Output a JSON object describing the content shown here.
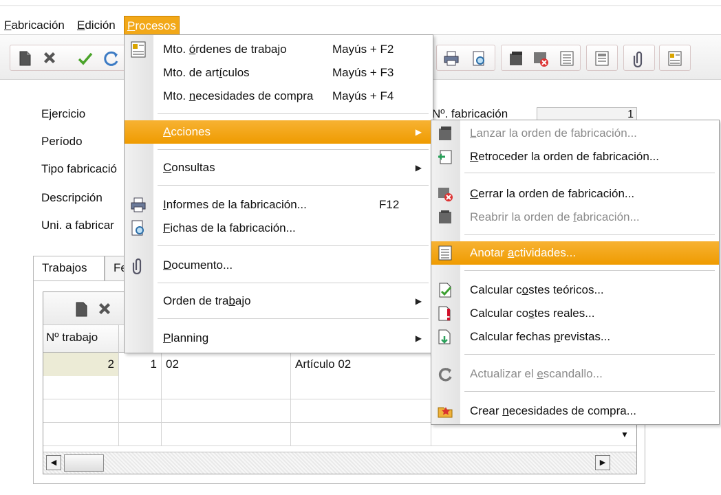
{
  "menubar": {
    "items": [
      {
        "pre": "",
        "key": "F",
        "post": "abricación"
      },
      {
        "pre": "",
        "key": "E",
        "post": "dición"
      },
      {
        "pre": "",
        "key": "P",
        "post": "rocesos"
      }
    ]
  },
  "form": {
    "labels": [
      "Ejercicio",
      "Período",
      "Tipo fabricació",
      "Descripción",
      "Uni. a fabricar"
    ],
    "fabricacion_label": "Nº. fabricación",
    "fabricacion_value": "1"
  },
  "tabs": [
    "Trabajos",
    "Fe"
  ],
  "grid": {
    "header_first": "Nº trabajo",
    "rows": [
      {
        "c1": "2",
        "c2": "1",
        "c3": "02",
        "c4": "Artículo 02"
      }
    ]
  },
  "procesos_menu": {
    "items": [
      {
        "pre": "Mto. ",
        "key": "ó",
        "post": "rdenes de trabajo",
        "shortcut": "Mayús + F2"
      },
      {
        "pre": "Mto. de art",
        "key": "í",
        "post": "culos",
        "shortcut": "Mayús + F3"
      },
      {
        "pre": "Mto. ",
        "key": "n",
        "post": "ecesidades de compra",
        "shortcut": "Mayús + F4"
      },
      {
        "pre": "",
        "key": "A",
        "post": "cciones"
      },
      {
        "pre": "",
        "key": "C",
        "post": "onsultas"
      },
      {
        "pre": "",
        "key": "I",
        "post": "nformes de la fabricación...",
        "shortcut": "F12"
      },
      {
        "pre": "",
        "key": "F",
        "post": "ichas de la fabricación..."
      },
      {
        "pre": "",
        "key": "D",
        "post": "ocumento..."
      },
      {
        "pre": "Orden de tra",
        "key": "b",
        "post": "ajo"
      },
      {
        "pre": "",
        "key": "P",
        "post": "lanning"
      }
    ]
  },
  "acciones_menu": {
    "items": [
      {
        "pre": "",
        "key": "L",
        "post": "anzar la orden de fabricación..."
      },
      {
        "pre": "",
        "key": "R",
        "post": "etroceder la orden de fabricación..."
      },
      {
        "pre": "",
        "key": "C",
        "post": "errar la orden de fabricación..."
      },
      {
        "pre": "Reabrir la orden de ",
        "key": "f",
        "post": "abricación..."
      },
      {
        "pre": "Anotar ",
        "key": "a",
        "post": "ctividades..."
      },
      {
        "pre": "Calcular c",
        "key": "o",
        "post": "stes teóricos..."
      },
      {
        "pre": "Calcular co",
        "key": "s",
        "post": "tes reales..."
      },
      {
        "pre": "Calcular fechas ",
        "key": "p",
        "post": "revistas..."
      },
      {
        "pre": "Actualizar el ",
        "key": "e",
        "post": "scandallo..."
      },
      {
        "pre": "Crear ",
        "key": "n",
        "post": "ecesidades de compra..."
      }
    ]
  },
  "colors": {
    "highlight": "#f2a818",
    "disabled_text": "#8b8b8b"
  }
}
